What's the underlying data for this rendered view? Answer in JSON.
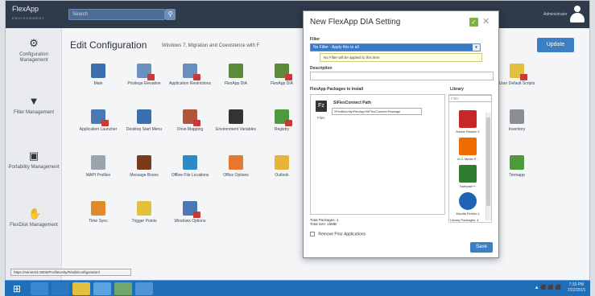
{
  "header": {
    "logo_line1": "FlexApp",
    "logo_line2": "ENVIRONMENT",
    "search_placeholder": "Search",
    "user_name": "Administrator"
  },
  "sidebar": {
    "items": [
      {
        "label": "Configuration Management",
        "icon": "gears-icon"
      },
      {
        "label": "Filter Management",
        "icon": "funnel-icon"
      },
      {
        "label": "Portability Management",
        "icon": "briefcase-icon"
      },
      {
        "label": "FlexDisk Management",
        "icon": "hand-icon"
      }
    ]
  },
  "main": {
    "title": "Edit Configuration",
    "subtitle": "Windows 7, Migration and Coexistence with F",
    "update_label": "Update"
  },
  "tiles": [
    {
      "label": "Main",
      "color": "#3c6fb0"
    },
    {
      "label": "Privilege Elevation",
      "color": "#6a8fc0"
    },
    {
      "label": "Application Restrictions",
      "color": "#6a8fc0"
    },
    {
      "label": "FlexApp DIA",
      "color": "#5a8a3a"
    },
    {
      "label": "FlexApp DIA",
      "color": "#5a8a3a"
    },
    {
      "label": "Application Launcher",
      "color": "#4a78b4"
    },
    {
      "label": "Desktop Start Menu",
      "color": "#3c6fb0"
    },
    {
      "label": "Drive Mapping",
      "color": "#b2553a"
    },
    {
      "label": "Environment Variables",
      "color": "#333333"
    },
    {
      "label": "Registry",
      "color": "#4c9a3c"
    },
    {
      "label": "MAPI Profiles",
      "color": "#9aa4ae"
    },
    {
      "label": "Message Boxes",
      "color": "#7a3b1b"
    },
    {
      "label": "Offline File Locations",
      "color": "#2c8bc7"
    },
    {
      "label": "Office Options",
      "color": "#e57a2e"
    },
    {
      "label": "Outlook",
      "color": "#e7b43a"
    },
    {
      "label": "Time Sync",
      "color": "#e08a2a"
    },
    {
      "label": "Trigger Points",
      "color": "#e3c13e"
    },
    {
      "label": "Windows Options",
      "color": "#4a78b4"
    },
    {
      "label": "User Default Scripts",
      "color": "#e3c13e"
    },
    {
      "label": "Inventory",
      "color": "#8b8f93"
    },
    {
      "label": "Termapp",
      "color": "#4c9a3c"
    }
  ],
  "dialog": {
    "title": "New FlexApp DIA Setting",
    "filter_label": "Filter",
    "filter_value": "No Filter - Apply this to all",
    "filter_tooltip": "No Filter will be applied to this item",
    "description_label": "Description",
    "packages_label": "FlexApp Packages to Install",
    "package": {
      "name": "SiFlexConnect Path",
      "path": "\\\\ProfileUnity\\FlexApp\\SiFlexConnect.Package",
      "file": "Files"
    },
    "library_label": "Library",
    "library_filter": "Filter",
    "library_items": [
      {
        "label": "Adobe Reader X",
        "color": "#c62828"
      },
      {
        "label": "VLC Media P...",
        "color": "#ef6c00"
      },
      {
        "label": "Notepad++",
        "color": "#2e7d32"
      },
      {
        "label": "Mozilla Firefox 4",
        "color": "#1e63b4"
      }
    ],
    "library_count": "Library Packages: 4",
    "stats_line1": "Total Packages: 1",
    "stats_line2": "Total size: 15MB",
    "remove_label": "Remove Prior Applications",
    "save_label": "Save"
  },
  "status_url": "https://server01:8000/ProfileUnity/#/edit/configuration/",
  "taskbar": {
    "tray": "▲ ⬛ ⬛ ⬛",
    "clock_line1": "7:33 PM",
    "clock_line2": "7/22/2015"
  }
}
